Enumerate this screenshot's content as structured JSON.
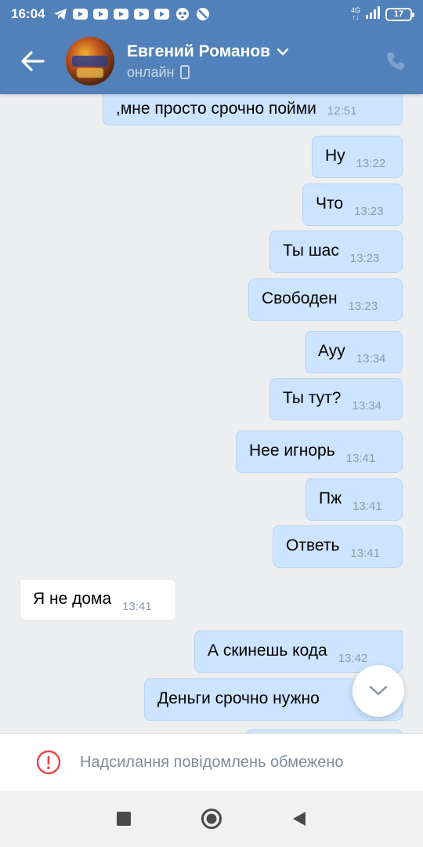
{
  "status_bar": {
    "time": "16:04",
    "network_top": "4G",
    "network_bottom": "↑↓",
    "battery": "17"
  },
  "header": {
    "contact_name": "Евгений Романов",
    "presence": "онлайн",
    "icons": {
      "back": "arrow-left-icon",
      "dropdown": "chevron-down-icon",
      "device": "phone-device-icon",
      "call": "phone-call-icon"
    }
  },
  "messages": [
    {
      "direction": "out",
      "text": ",мне просто срочно пойми",
      "time": "12:51"
    },
    {
      "direction": "out",
      "text": "Ну",
      "time": "13:22"
    },
    {
      "direction": "out",
      "text": "Что",
      "time": "13:23"
    },
    {
      "direction": "out",
      "text": "Ты шас",
      "time": "13:23"
    },
    {
      "direction": "out",
      "text": "Свободен",
      "time": "13:23"
    },
    {
      "direction": "out",
      "text": "Ауу",
      "time": "13:34"
    },
    {
      "direction": "out",
      "text": "Ты тут?",
      "time": "13:34"
    },
    {
      "direction": "out",
      "text": "Нее игнорь",
      "time": "13:41"
    },
    {
      "direction": "out",
      "text": "Пж",
      "time": "13:41"
    },
    {
      "direction": "out",
      "text": "Ответь",
      "time": "13:41"
    },
    {
      "direction": "in",
      "text": "Я не дома",
      "time": "13:41"
    },
    {
      "direction": "out",
      "text": "А скинешь кода",
      "time": "13:42"
    },
    {
      "direction": "out",
      "text": "Деньги срочно нужно",
      "time": ""
    }
  ],
  "restriction_notice": "Надсилання повідомлень обмежено",
  "colors": {
    "header_bg": "#5181b8",
    "outgoing_bubble": "#cce4ff",
    "incoming_bubble": "#ffffff",
    "chat_bg": "#edeef0",
    "warning_red": "#e64646"
  }
}
